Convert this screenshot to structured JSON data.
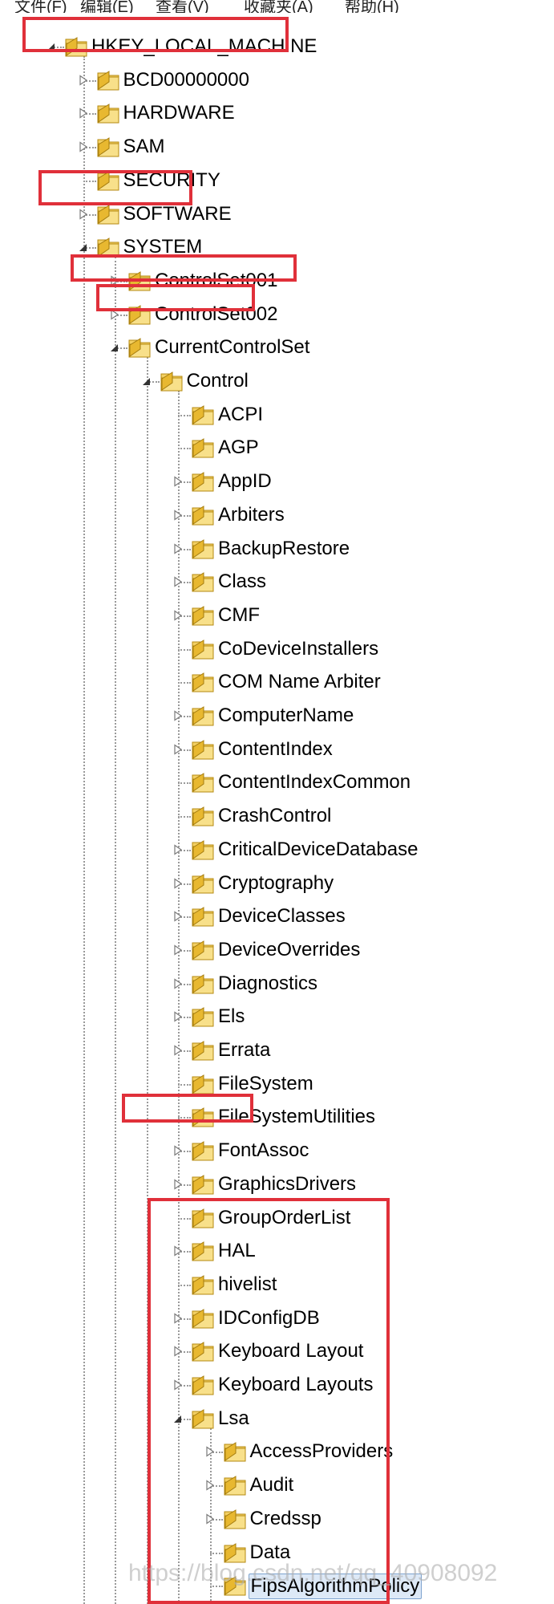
{
  "menu": [
    "文件(F)",
    "编辑(E)",
    "查看(V)",
    "收藏夹(A)",
    "帮助(H)"
  ],
  "colors": {
    "highlight_box": "#e0303a",
    "selection_bg": "#dde9f7",
    "folder_yellow": "#e8b830"
  },
  "tree": [
    {
      "label": "HKEY_LOCAL_MACHINE",
      "depth": 0,
      "state": "expanded",
      "highlighted": true
    },
    {
      "label": "BCD00000000",
      "depth": 1,
      "state": "collapsed"
    },
    {
      "label": "HARDWARE",
      "depth": 1,
      "state": "collapsed"
    },
    {
      "label": "SAM",
      "depth": 1,
      "state": "collapsed"
    },
    {
      "label": "SECURITY",
      "depth": 1,
      "state": "leaf"
    },
    {
      "label": "SOFTWARE",
      "depth": 1,
      "state": "collapsed"
    },
    {
      "label": "SYSTEM",
      "depth": 1,
      "state": "expanded",
      "highlighted": true
    },
    {
      "label": "ControlSet001",
      "depth": 2,
      "state": "collapsed"
    },
    {
      "label": "ControlSet002",
      "depth": 2,
      "state": "collapsed"
    },
    {
      "label": "CurrentControlSet",
      "depth": 2,
      "state": "expanded",
      "highlighted": true
    },
    {
      "label": "Control",
      "depth": 3,
      "state": "expanded",
      "highlighted": true
    },
    {
      "label": "ACPI",
      "depth": 4,
      "state": "leaf"
    },
    {
      "label": "AGP",
      "depth": 4,
      "state": "leaf"
    },
    {
      "label": "AppID",
      "depth": 4,
      "state": "collapsed"
    },
    {
      "label": "Arbiters",
      "depth": 4,
      "state": "collapsed"
    },
    {
      "label": "BackupRestore",
      "depth": 4,
      "state": "collapsed"
    },
    {
      "label": "Class",
      "depth": 4,
      "state": "collapsed"
    },
    {
      "label": "CMF",
      "depth": 4,
      "state": "collapsed"
    },
    {
      "label": "CoDeviceInstallers",
      "depth": 4,
      "state": "leaf"
    },
    {
      "label": "COM Name Arbiter",
      "depth": 4,
      "state": "leaf"
    },
    {
      "label": "ComputerName",
      "depth": 4,
      "state": "collapsed"
    },
    {
      "label": "ContentIndex",
      "depth": 4,
      "state": "collapsed"
    },
    {
      "label": "ContentIndexCommon",
      "depth": 4,
      "state": "leaf"
    },
    {
      "label": "CrashControl",
      "depth": 4,
      "state": "leaf"
    },
    {
      "label": "CriticalDeviceDatabase",
      "depth": 4,
      "state": "collapsed"
    },
    {
      "label": "Cryptography",
      "depth": 4,
      "state": "collapsed"
    },
    {
      "label": "DeviceClasses",
      "depth": 4,
      "state": "collapsed"
    },
    {
      "label": "DeviceOverrides",
      "depth": 4,
      "state": "collapsed"
    },
    {
      "label": "Diagnostics",
      "depth": 4,
      "state": "collapsed"
    },
    {
      "label": "Els",
      "depth": 4,
      "state": "collapsed"
    },
    {
      "label": "Errata",
      "depth": 4,
      "state": "collapsed"
    },
    {
      "label": "FileSystem",
      "depth": 4,
      "state": "leaf"
    },
    {
      "label": "FileSystemUtilities",
      "depth": 4,
      "state": "leaf"
    },
    {
      "label": "FontAssoc",
      "depth": 4,
      "state": "collapsed"
    },
    {
      "label": "GraphicsDrivers",
      "depth": 4,
      "state": "collapsed"
    },
    {
      "label": "GroupOrderList",
      "depth": 4,
      "state": "leaf"
    },
    {
      "label": "HAL",
      "depth": 4,
      "state": "collapsed"
    },
    {
      "label": "hivelist",
      "depth": 4,
      "state": "leaf"
    },
    {
      "label": "IDConfigDB",
      "depth": 4,
      "state": "collapsed"
    },
    {
      "label": "Keyboard Layout",
      "depth": 4,
      "state": "collapsed"
    },
    {
      "label": "Keyboard Layouts",
      "depth": 4,
      "state": "collapsed"
    },
    {
      "label": "Lsa",
      "depth": 4,
      "state": "expanded",
      "highlighted": true
    },
    {
      "label": "AccessProviders",
      "depth": 5,
      "state": "collapsed"
    },
    {
      "label": "Audit",
      "depth": 5,
      "state": "collapsed"
    },
    {
      "label": "Credssp",
      "depth": 5,
      "state": "collapsed"
    },
    {
      "label": "Data",
      "depth": 5,
      "state": "leaf",
      "highlighted": true
    },
    {
      "label": "FipsAlgorithmPolicy",
      "depth": 5,
      "state": "leaf",
      "highlighted": true,
      "selected": true
    }
  ],
  "watermark": "https://blog.csdn.net/qq_40908092"
}
